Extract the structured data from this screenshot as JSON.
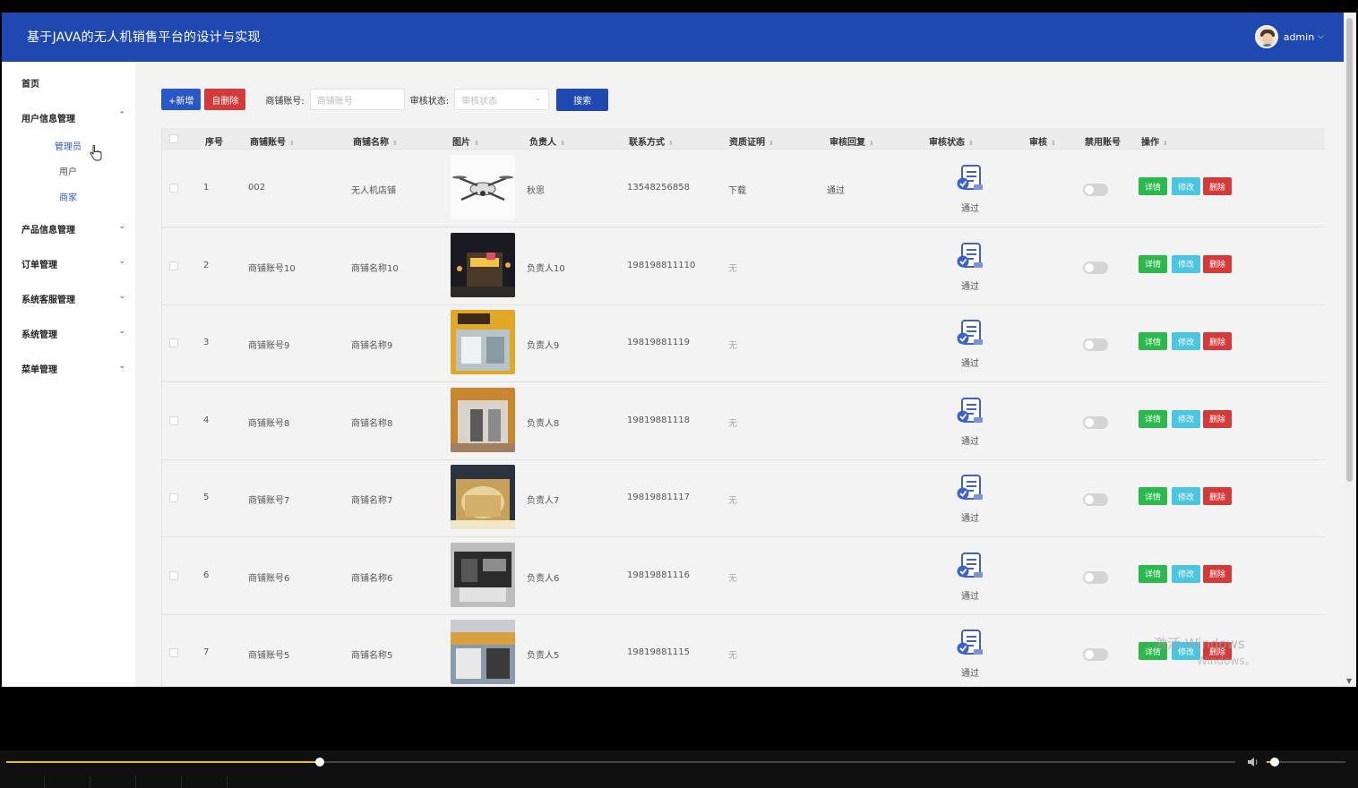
{
  "header": {
    "title": "基于JAVA的无人机销售平台的设计与实现",
    "username": "admin",
    "chevron": "⌵"
  },
  "sidebar": {
    "home": "首页",
    "user_mgmt": "用户信息管理",
    "sub": [
      "管理员",
      "用户",
      "商家"
    ],
    "product_mgmt": "产品信息管理",
    "order_mgmt": "订单管理",
    "service_mgmt": "系统客服管理",
    "system_mgmt": "系统管理",
    "menu_mgmt": "菜单管理",
    "chev_up": "⌃",
    "chev_down": "⌄"
  },
  "toolbar": {
    "add_label": "+新增",
    "delete_label": "自删除",
    "account_label": "商铺账号:",
    "account_placeholder": "商铺账号",
    "status_label": "审核状态:",
    "status_placeholder": "审核状态",
    "search_label": "搜索"
  },
  "table": {
    "columns": [
      "序号",
      "商铺账号",
      "商铺名称",
      "图片",
      "负责人",
      "联系方式",
      "资质证明",
      "审核回复",
      "审核状态",
      "审核",
      "禁用账号",
      "操作"
    ],
    "sort_symbol": "⇕",
    "rows": [
      {
        "no": "1",
        "account": "002",
        "name": "无人机店铺",
        "owner": "秋思",
        "phone": "13548256858",
        "proof": "下载",
        "reply": "通过",
        "status": "通过"
      },
      {
        "no": "2",
        "account": "商铺账号10",
        "name": "商铺名称10",
        "owner": "负责人10",
        "phone": "198198811110",
        "proof": "无",
        "reply": "",
        "status": "通过"
      },
      {
        "no": "3",
        "account": "商铺账号9",
        "name": "商铺名称9",
        "owner": "负责人9",
        "phone": "19819881119",
        "proof": "无",
        "reply": "",
        "status": "通过"
      },
      {
        "no": "4",
        "account": "商铺账号8",
        "name": "商铺名称8",
        "owner": "负责人8",
        "phone": "19819881118",
        "proof": "无",
        "reply": "",
        "status": "通过"
      },
      {
        "no": "5",
        "account": "商铺账号7",
        "name": "商铺名称7",
        "owner": "负责人7",
        "phone": "19819881117",
        "proof": "无",
        "reply": "",
        "status": "通过"
      },
      {
        "no": "6",
        "account": "商铺账号6",
        "name": "商铺名称6",
        "owner": "负责人6",
        "phone": "19819881116",
        "proof": "无",
        "reply": "",
        "status": "通过"
      },
      {
        "no": "7",
        "account": "商铺账号5",
        "name": "商铺名称5",
        "owner": "负责人5",
        "phone": "19819881115",
        "proof": "无",
        "reply": "",
        "status": "通过"
      }
    ],
    "actions": {
      "detail": "详情",
      "edit": "修改",
      "delete": "删除"
    }
  },
  "watermark": {
    "line1": "激活 Windows",
    "line2": "Windows。"
  },
  "player": {
    "progress": 0.255,
    "volume": 0.1
  },
  "colors": {
    "header": "#1f48b0",
    "add": "#2a57c6",
    "danger": "#d43a3a",
    "detail": "#2db84d",
    "edit": "#4cc5e0",
    "progress": "#e8c21a"
  }
}
